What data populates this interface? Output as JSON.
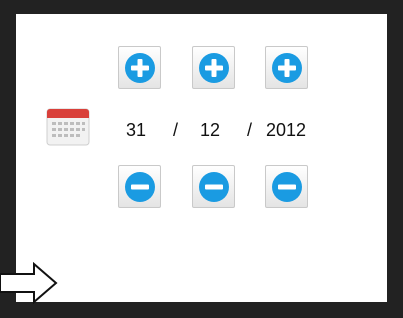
{
  "date": {
    "day": "31",
    "separator_1": "/",
    "month": "12",
    "separator_2": "/",
    "year": "2012"
  },
  "icons": {
    "calendar": "calendar-icon",
    "increment": "plus-circle-icon",
    "decrement": "minus-circle-icon",
    "cursor": "arrow-right-icon"
  },
  "colors": {
    "button_icon": "#1a9be2",
    "frame": "#222222",
    "calendar_header": "#d9403a"
  }
}
